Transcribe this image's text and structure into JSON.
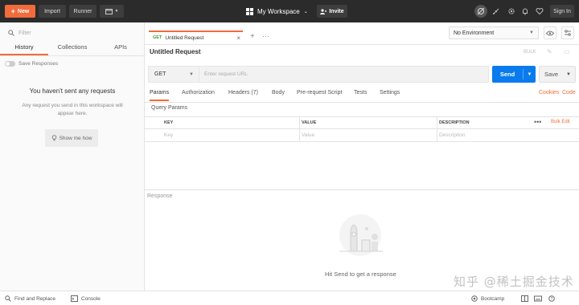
{
  "topbar": {
    "new_label": "New",
    "import_label": "Import",
    "runner_label": "Runner",
    "workspace_label": "My Workspace",
    "invite_label": "Invite",
    "signin_label": "Sign In"
  },
  "sidebar": {
    "filter_placeholder": "Filter",
    "tabs": [
      {
        "label": "History"
      },
      {
        "label": "Collections"
      },
      {
        "label": "APIs"
      }
    ],
    "save_responses_label": "Save Responses",
    "empty_title": "You haven't sent any requests",
    "empty_desc": "Any request you send in this workspace will appear here.",
    "show_me_label": "Show me how"
  },
  "request_tab": {
    "method": "GET",
    "title": "Untitled Request"
  },
  "environment": {
    "selected": "No Environment"
  },
  "request": {
    "title": "Untitled Request",
    "bulk_label": "BULK",
    "method": "GET",
    "url_placeholder": "Enter request URL",
    "send_label": "Send",
    "save_label": "Save"
  },
  "subtabs": [
    {
      "label": "Params"
    },
    {
      "label": "Authorization"
    },
    {
      "label": "Headers (7)"
    },
    {
      "label": "Body"
    },
    {
      "label": "Pre-request Script"
    },
    {
      "label": "Tests"
    },
    {
      "label": "Settings"
    }
  ],
  "cookies_label": "Cookies",
  "code_label": "Code",
  "query_params_label": "Query Params",
  "params_table": {
    "headers": [
      "KEY",
      "VALUE",
      "DESCRIPTION"
    ],
    "placeholders": [
      "Key",
      "Value",
      "Description"
    ],
    "bulk_edit_label": "Bulk Edit"
  },
  "response": {
    "label": "Response",
    "hint": "Hit Send to get a response"
  },
  "watermark": "知乎 @稀土掘金技术社区",
  "statusbar": {
    "find_replace_label": "Find and Replace",
    "console_label": "Console",
    "bootcamp_label": "Bootcamp"
  },
  "colors": {
    "accent": "#f26b3a",
    "send_blue": "#097bed",
    "topbar_bg": "#2b2b2b"
  }
}
